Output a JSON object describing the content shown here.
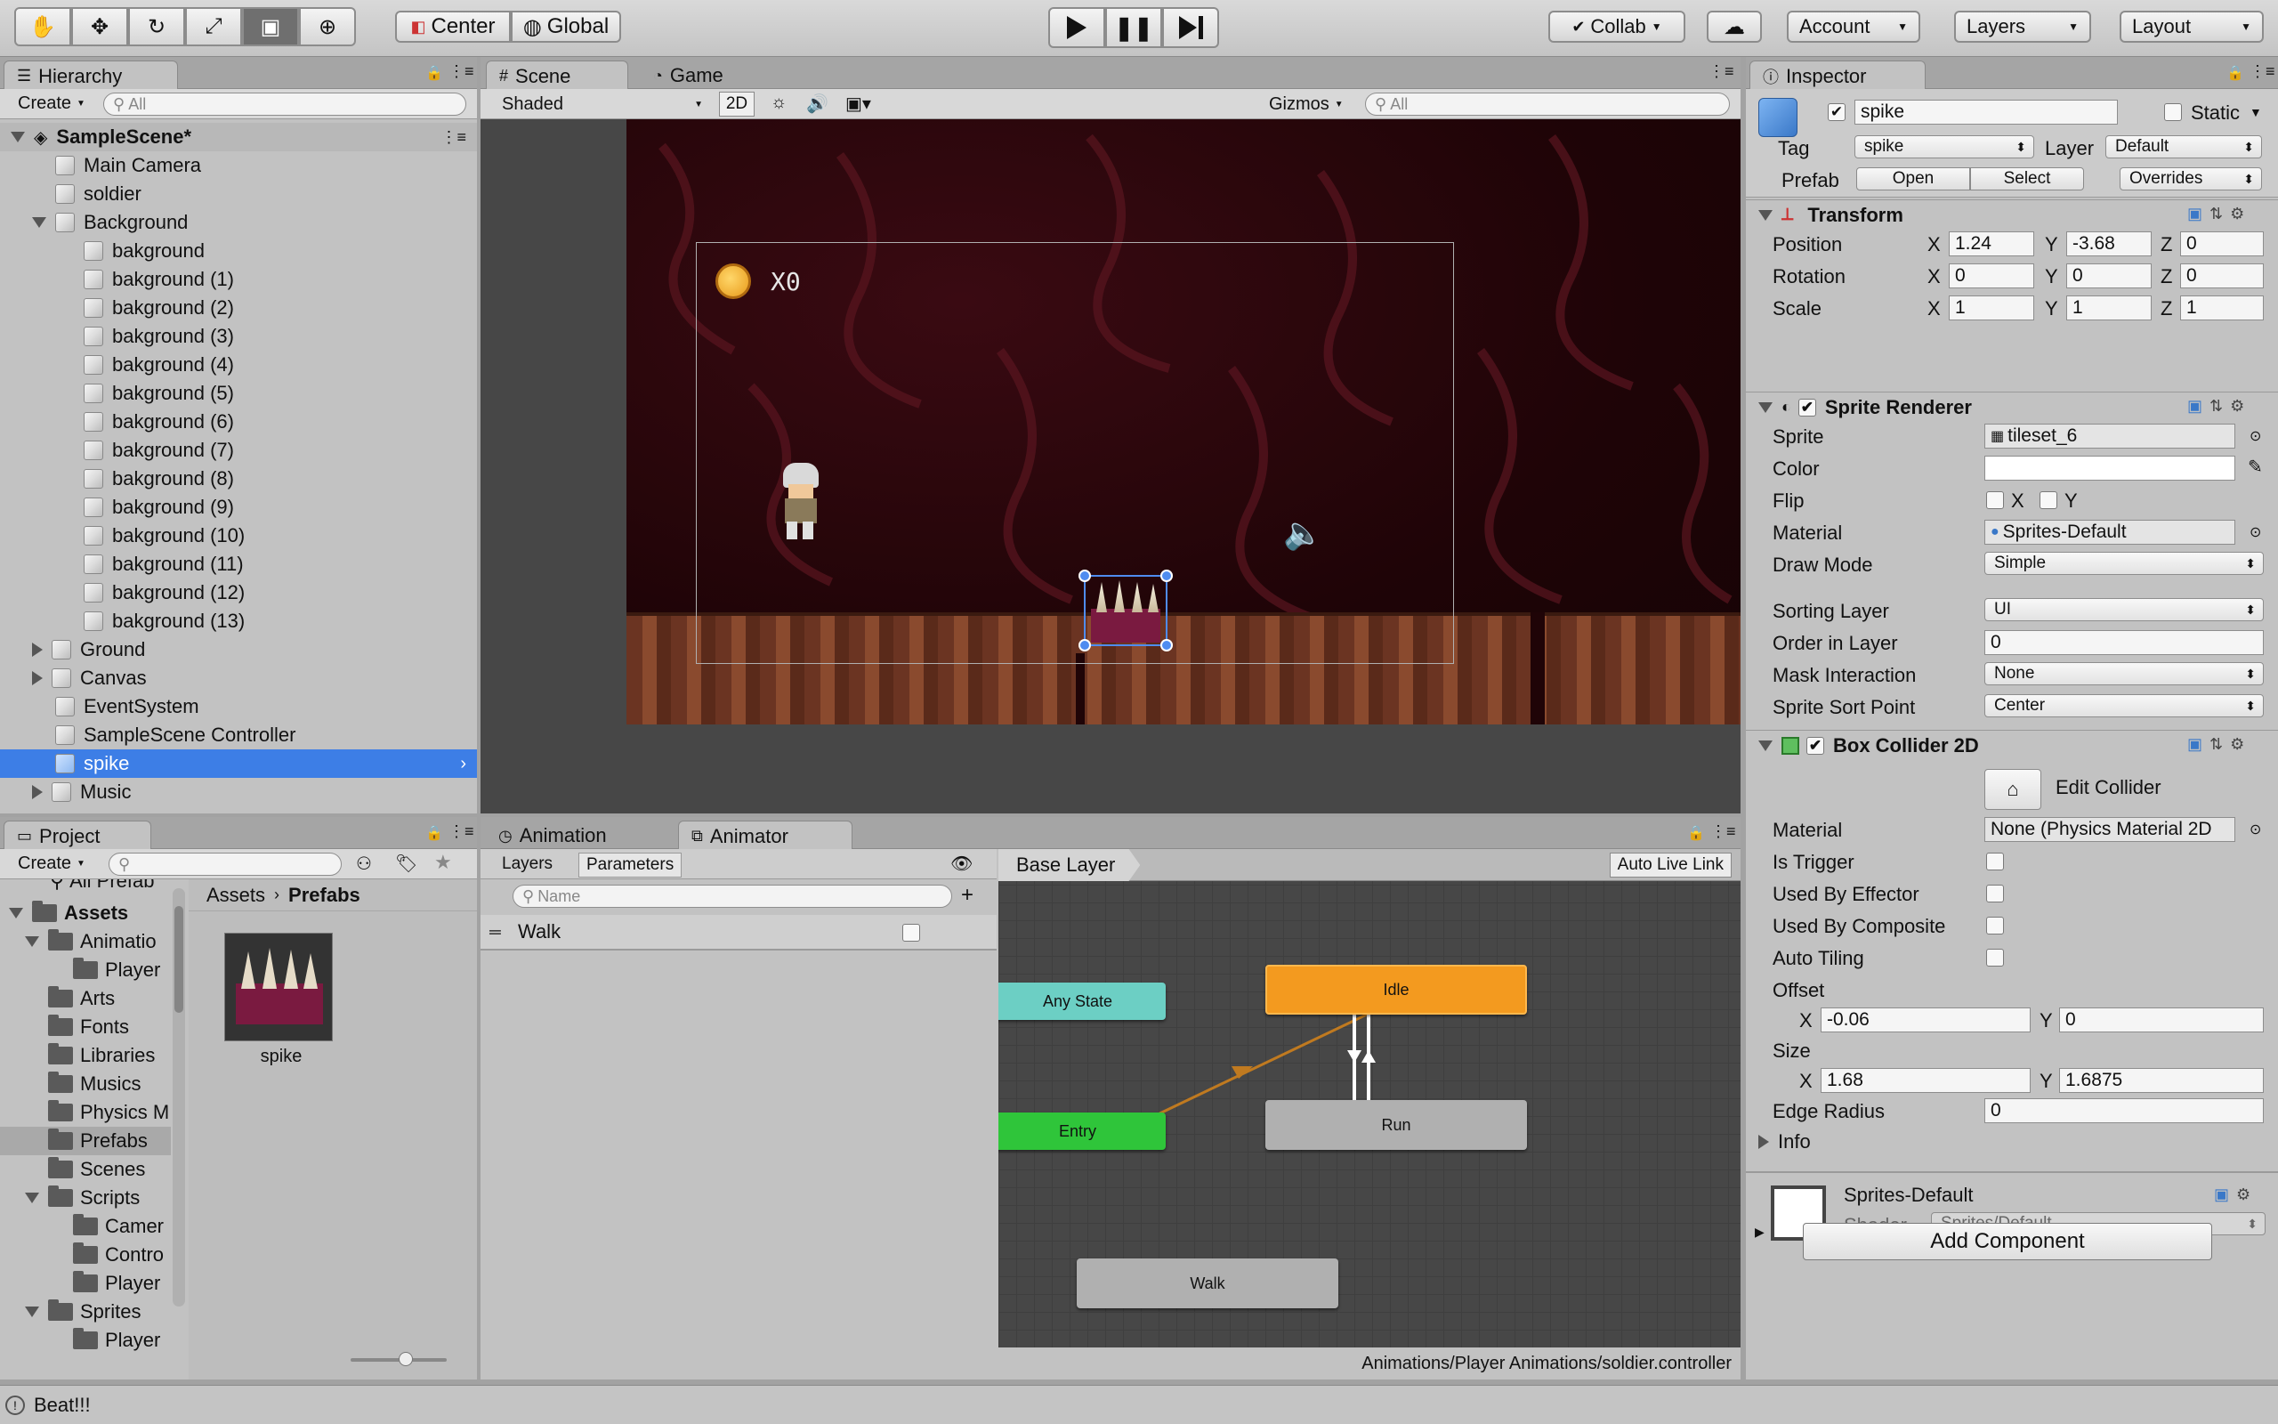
{
  "toolbar": {
    "tools": [
      "hand-tool-icon",
      "move-tool-icon",
      "rotate-tool-icon",
      "scale-tool-icon",
      "rect-tool-icon",
      "transform-tool-icon"
    ],
    "pivot_label": "Center",
    "space_label": "Global",
    "collab_label": "Collab",
    "account_label": "Account",
    "layers_label": "Layers",
    "layout_label": "Layout"
  },
  "hierarchy": {
    "tab": "Hierarchy",
    "create": "Create",
    "search_placeholder": "All",
    "scene": "SampleScene*",
    "items": [
      {
        "label": "Main Camera"
      },
      {
        "label": "soldier"
      },
      {
        "label": "Background"
      },
      {
        "label": "bakground"
      },
      {
        "label": "bakground (1)"
      },
      {
        "label": "bakground (2)"
      },
      {
        "label": "bakground (3)"
      },
      {
        "label": "bakground (4)"
      },
      {
        "label": "bakground (5)"
      },
      {
        "label": "bakground (6)"
      },
      {
        "label": "bakground (7)"
      },
      {
        "label": "bakground (8)"
      },
      {
        "label": "bakground (9)"
      },
      {
        "label": "bakground (10)"
      },
      {
        "label": "bakground (11)"
      },
      {
        "label": "bakground (12)"
      },
      {
        "label": "bakground (13)"
      },
      {
        "label": "Ground"
      },
      {
        "label": "Canvas"
      },
      {
        "label": "EventSystem"
      },
      {
        "label": "SampleScene Controller"
      },
      {
        "label": "spike"
      },
      {
        "label": "Music"
      }
    ]
  },
  "scene_view": {
    "tab_scene": "Scene",
    "tab_game": "Game",
    "shading": "Shaded",
    "mode_2d": "2D",
    "gizmos": "Gizmos",
    "search_placeholder": "All",
    "coin_count": "X0"
  },
  "project": {
    "tab": "Project",
    "create": "Create",
    "breadcrumb_root": "Assets",
    "breadcrumb_current": "Prefabs",
    "partial_top": "All Prefab",
    "tree": [
      {
        "label": "Assets"
      },
      {
        "label": "Animatio"
      },
      {
        "label": "Player"
      },
      {
        "label": "Arts"
      },
      {
        "label": "Fonts"
      },
      {
        "label": "Libraries"
      },
      {
        "label": "Musics"
      },
      {
        "label": "Physics M"
      },
      {
        "label": "Prefabs"
      },
      {
        "label": "Scenes"
      },
      {
        "label": "Scripts"
      },
      {
        "label": "Camer"
      },
      {
        "label": "Contro"
      },
      {
        "label": "Player"
      },
      {
        "label": "Sprites"
      },
      {
        "label": "Player"
      }
    ],
    "asset_name": "spike"
  },
  "animator": {
    "tab_animation": "Animation",
    "tab_animator": "Animator",
    "layers": "Layers",
    "parameters": "Parameters",
    "name_placeholder": "Name",
    "param_walk": "Walk",
    "base_layer": "Base Layer",
    "auto_live_link": "Auto Live Link",
    "states": {
      "any_state": "Any State",
      "entry": "Entry",
      "idle": "Idle",
      "run": "Run",
      "walk": "Walk"
    },
    "path": "Animations/Player Animations/soldier.controller"
  },
  "inspector": {
    "tab": "Inspector",
    "object_name": "spike",
    "static": "Static",
    "tag_label": "Tag",
    "tag_value": "spike",
    "layer_label": "Layer",
    "layer_value": "Default",
    "prefab_label": "Prefab",
    "open": "Open",
    "select": "Select",
    "overrides": "Overrides",
    "transform": {
      "title": "Transform",
      "position_label": "Position",
      "rotation_label": "Rotation",
      "scale_label": "Scale",
      "position": {
        "x": "1.24",
        "y": "-3.68",
        "z": "0"
      },
      "rotation": {
        "x": "0",
        "y": "0",
        "z": "0"
      },
      "scale": {
        "x": "1",
        "y": "1",
        "z": "1"
      }
    },
    "sprite_renderer": {
      "title": "Sprite Renderer",
      "sprite_label": "Sprite",
      "sprite": "tileset_6",
      "color_label": "Color",
      "flip_label": "Flip",
      "material_label": "Material",
      "material": "Sprites-Default",
      "draw_mode_label": "Draw Mode",
      "draw_mode": "Simple",
      "sorting_layer_label": "Sorting Layer",
      "sorting_layer": "UI",
      "order_label": "Order in Layer",
      "order": "0",
      "mask_label": "Mask Interaction",
      "mask": "None",
      "sort_point_label": "Sprite Sort Point",
      "sort_point": "Center"
    },
    "box_collider": {
      "title": "Box Collider 2D",
      "edit_collider": "Edit Collider",
      "material_label": "Material",
      "material": "None (Physics Material 2D",
      "is_trigger": "Is Trigger",
      "used_by_effector": "Used By Effector",
      "used_by_composite": "Used By Composite",
      "auto_tiling": "Auto Tiling",
      "offset_label": "Offset",
      "offset": {
        "x": "-0.06",
        "y": "0"
      },
      "size_label": "Size",
      "size": {
        "x": "1.68",
        "y": "1.6875"
      },
      "edge_radius_label": "Edge Radius",
      "edge_radius": "0",
      "info": "Info"
    },
    "material_asset": {
      "name": "Sprites-Default",
      "shader_label": "Shader",
      "shader": "Sprites/Default"
    },
    "add_component": "Add Component"
  },
  "status_bar": {
    "message": "Beat!!!"
  },
  "colors": {
    "selection": "#3d7ee6",
    "idle_state": "#f39a1f",
    "entry_state": "#2fc53a",
    "any_state": "#6ccfc4"
  }
}
